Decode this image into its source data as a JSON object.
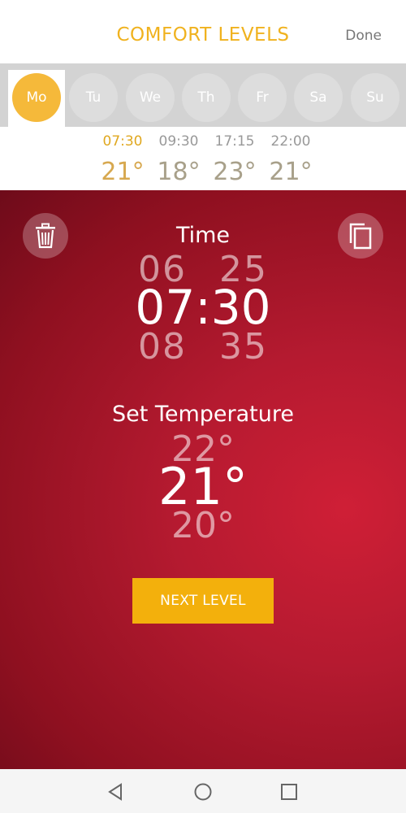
{
  "header": {
    "title": "COMFORT LEVELS",
    "done_label": "Done"
  },
  "days": [
    {
      "label": "Mo",
      "selected": true
    },
    {
      "label": "Tu",
      "selected": false
    },
    {
      "label": "We",
      "selected": false
    },
    {
      "label": "Th",
      "selected": false
    },
    {
      "label": "Fr",
      "selected": false
    },
    {
      "label": "Sa",
      "selected": false
    },
    {
      "label": "Su",
      "selected": false
    }
  ],
  "schedule": [
    {
      "time": "07:30",
      "temp": "21°",
      "active": true
    },
    {
      "time": "09:30",
      "temp": "18°",
      "active": false
    },
    {
      "time": "17:15",
      "temp": "23°",
      "active": false
    },
    {
      "time": "22:00",
      "temp": "21°",
      "active": false
    }
  ],
  "editor": {
    "time_label": "Time",
    "time_prev": "06 25",
    "time_current": "07:30",
    "time_next": "08 35",
    "temp_label": "Set Temperature",
    "temp_prev": "22°",
    "temp_current": "21°",
    "temp_next": "20°",
    "next_label": "NEXT LEVEL",
    "delete_icon": "trash-icon",
    "copy_icon": "copy-icon"
  },
  "colors": {
    "accent": "#f3b00c",
    "panel": "#b51a30"
  },
  "navbar": {
    "icons": [
      "back-icon",
      "home-icon",
      "recents-icon"
    ]
  }
}
